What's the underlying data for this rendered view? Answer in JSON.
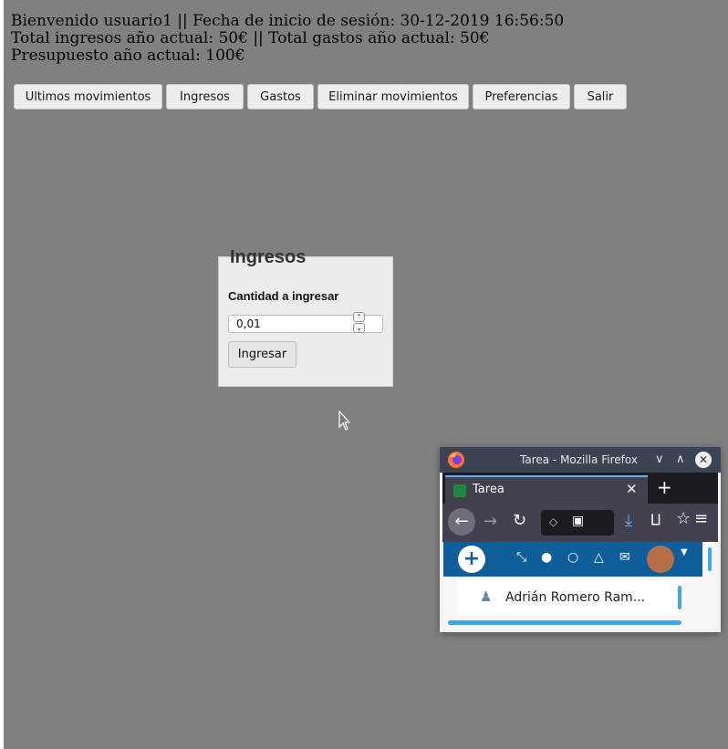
{
  "header": {
    "line1": "Bienvenido usuario1 || Fecha de inicio de sesión: 30-12-2019 16:56:50",
    "line2": "Total ingresos año actual: 50€ || Total gastos año actual: 50€",
    "line3": "Presupuesto año actual: 100€"
  },
  "nav": {
    "ultimos": "Ultimos movimientos",
    "ingresos": "Ingresos",
    "gastos": "Gastos",
    "eliminar": "Eliminar movimientos",
    "preferencias": "Preferencias",
    "salir": "Salir"
  },
  "form": {
    "title": "Ingresos",
    "quantity_label": "Cantidad a ingresar",
    "quantity_value": "0,01",
    "submit_label": "Ingresar"
  },
  "firefox": {
    "window_title": "Tarea - Mozilla Firefox",
    "tab_label": "Tarea",
    "user_name": "Adrián Romero Ram..."
  },
  "colors": {
    "page_background": "#808080",
    "firefox_accent": "#0d5e99"
  }
}
